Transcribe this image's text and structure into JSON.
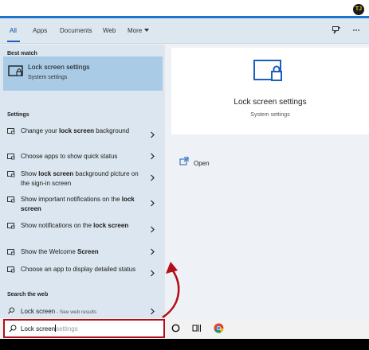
{
  "tabs": [
    {
      "label": "All",
      "active": true
    },
    {
      "label": "Apps"
    },
    {
      "label": "Documents"
    },
    {
      "label": "Web"
    },
    {
      "label": "More"
    }
  ],
  "sections": {
    "best_match": "Best match",
    "settings": "Settings",
    "search_web": "Search the web"
  },
  "best_match": {
    "title_bold": "Lock screen",
    "title_rest": " settings",
    "subtitle": "System settings"
  },
  "settings_items": [
    {
      "pre": "Change your ",
      "bold": "lock screen",
      "post": " background"
    },
    {
      "pre": "Choose apps to show quick status",
      "bold": "",
      "post": ""
    },
    {
      "pre": "Show ",
      "bold": "lock screen",
      "post": " background picture on the sign-in screen"
    },
    {
      "pre": "Show important notifications on the ",
      "bold": "lock screen",
      "post": ""
    },
    {
      "pre": "Show notifications on the ",
      "bold": "lock screen",
      "post": ""
    },
    {
      "pre": "Show the Welcome ",
      "bold": "Screen",
      "post": ""
    },
    {
      "pre": "Choose an app to display detailed status",
      "bold": "",
      "post": ""
    }
  ],
  "web_item": {
    "label": "Lock screen",
    "suffix": " - See web results"
  },
  "right": {
    "title": "Lock screen settings",
    "subtitle": "System settings",
    "open_label": "Open"
  },
  "search": {
    "typed": "Lock screen",
    "ghost": "settings"
  },
  "colors": {
    "accent": "#1a5fbf",
    "highlight": "#a9cbe6",
    "annotation_red": "#b10f1a"
  }
}
